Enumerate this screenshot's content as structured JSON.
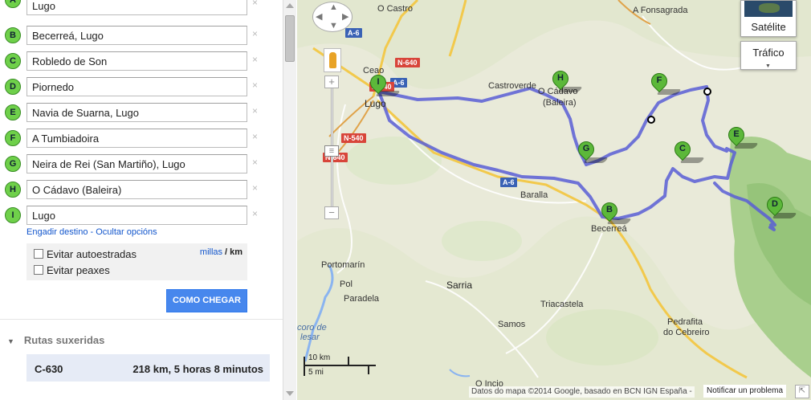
{
  "waypoints": [
    {
      "marker": "A",
      "value": "Lugo"
    },
    {
      "marker": "B",
      "value": "Becerreá, Lugo"
    },
    {
      "marker": "C",
      "value": "Robledo de Son"
    },
    {
      "marker": "D",
      "value": "Piornedo"
    },
    {
      "marker": "E",
      "value": "Navia de Suarna, Lugo"
    },
    {
      "marker": "F",
      "value": "A Tumbiadoira"
    },
    {
      "marker": "G",
      "value": "Neira de Rei (San Martiño), Lugo"
    },
    {
      "marker": "H",
      "value": "O Cádavo (Baleira)"
    },
    {
      "marker": "I",
      "value": "Lugo"
    }
  ],
  "remove_glyph": "×",
  "links": {
    "add_destination": "Engadir destino",
    "separator": " - ",
    "hide_options": "Ocultar opcións"
  },
  "options": {
    "avoid_highways": "Evitar autoestradas",
    "avoid_tolls": "Evitar peaxes",
    "unit_miles": "millas",
    "unit_slash": "/",
    "unit_km": "km"
  },
  "go_button": "COMO CHEGAR",
  "routes": {
    "title": "Rutas suxeridas",
    "items": [
      {
        "name": "C-630",
        "summary": "218 km, 5 horas 8 minutos"
      }
    ]
  },
  "map": {
    "places": {
      "o_castro": "O Castro",
      "a_fonsagrada": "A Fonsagrada",
      "ceao": "Ceao",
      "lugo": "Lugo",
      "castroverde": "Castroverde",
      "o_cadavo": "O Cádavo",
      "baleira": "(Baleira)",
      "baralla": "Baralla",
      "becerrea": "Becerreá",
      "portomarin": "Portomarín",
      "pol": "Pol",
      "paradela": "Paradela",
      "sarria": "Sarria",
      "triacastela": "Triacastela",
      "samos": "Samos",
      "pedrafita_1": "Pedrafita",
      "pedrafita_2": "do Cebreiro",
      "o_incio": "O Incio",
      "encoro": "coro de",
      "elesar": "lesar"
    },
    "shields": {
      "a6_north": "A-6",
      "n640_north": "N-640",
      "a6_lugo": "A-6",
      "n540_a": "N-540",
      "n540_b": "N-540",
      "n640_south": "N-640",
      "a6_east": "A-6"
    },
    "route_pins": [
      "I",
      "H",
      "F",
      "G",
      "C",
      "E",
      "B",
      "D"
    ],
    "controls": {
      "satellite": "Satélite",
      "traffic": "Tráfico",
      "zoom_in": "+",
      "zoom_out": "−"
    },
    "scale": {
      "km": "10 km",
      "mi": "5 mi"
    },
    "attribution": "Datos do mapa ©2014 Google, basado en BCN IGN España",
    "attribution_sep": " - ",
    "report": "Notificar un problema",
    "colors": {
      "route": "#5a5fd6",
      "highway": "#f2c94c",
      "land": "#eaead8",
      "forest": "#a8d08a"
    }
  }
}
